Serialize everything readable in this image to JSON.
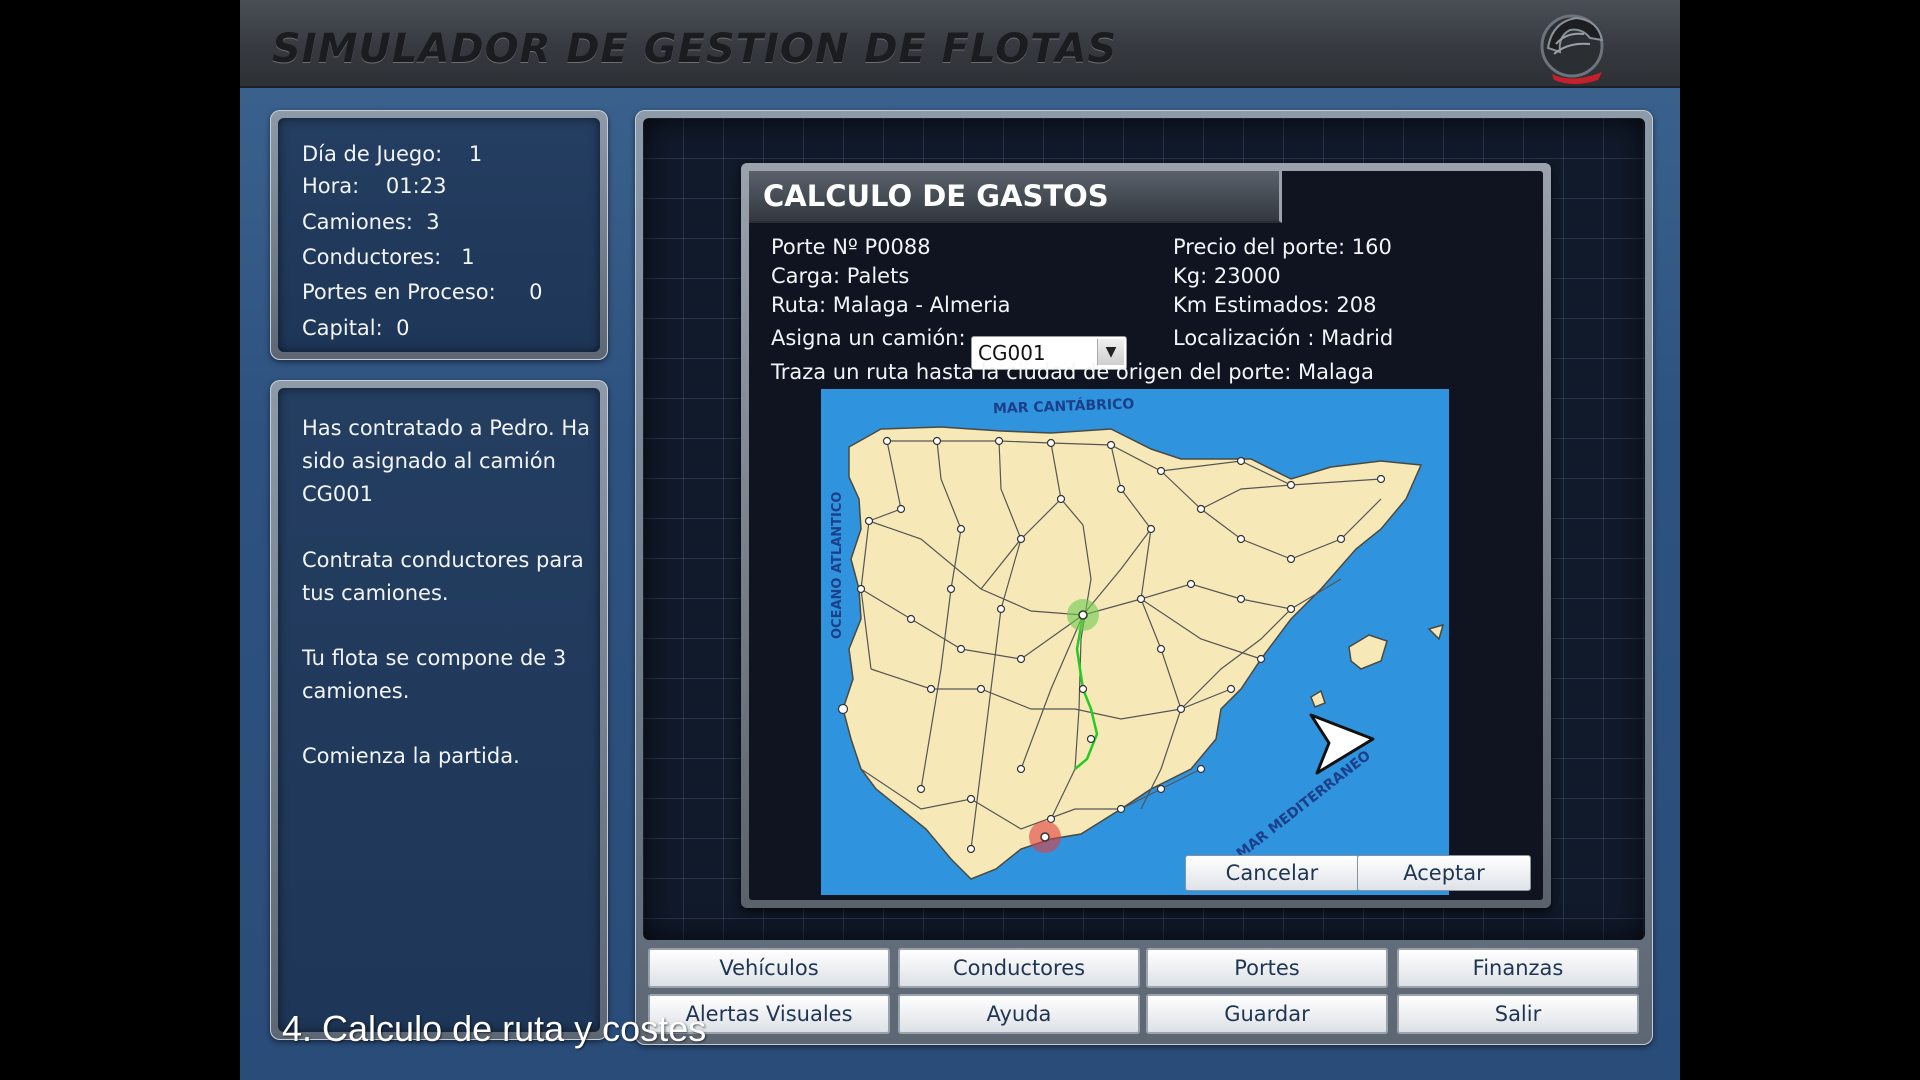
{
  "app": {
    "title": "SIMULADOR DE GESTION DE FLOTAS"
  },
  "stats": {
    "dia_label": "Día de Juego:",
    "dia_value": "1",
    "hora_label": "Hora:",
    "hora_value": "01:23",
    "camiones_label": "Camiones:",
    "camiones_value": "3",
    "conductores_label": "Conductores:",
    "conductores_value": "1",
    "portes_label": "Portes en Proceso:",
    "portes_value": "0",
    "capital_label": "Capital:",
    "capital_value": "0"
  },
  "messages": [
    "Has contratado a Pedro. Ha sido asignado al camión CG001",
    "Contrata conductores para tus camiones.",
    "Tu flota se compone de 3 camiones.",
    "Comienza la partida."
  ],
  "dialog": {
    "title": "CALCULO DE GASTOS",
    "porte": "Porte Nº P0088",
    "carga": "Carga: Palets",
    "ruta": "Ruta: Malaga - Almeria",
    "asigna_label": "Asigna un camión:",
    "truck_selected": "CG001",
    "precio": "Precio del porte: 160",
    "kg": "Kg: 23000",
    "km": "Km Estimados: 208",
    "localizacion": "Localización : Madrid",
    "instruction": "Traza un ruta hasta la ciudad de origen del porte: Malaga",
    "cancel_label": "Cancelar",
    "accept_label": "Aceptar"
  },
  "map": {
    "sea_north": "MAR CANTÁBRICO",
    "sea_west": "OCEANO ATLANTICO",
    "sea_east": "MAR MEDITERRANEO",
    "colors": {
      "sea": "#2f93de",
      "land": "#f7e8b8",
      "route": "#22cc22",
      "origin": "#e04040",
      "current": "#6ccb50"
    }
  },
  "nav": {
    "row1": [
      "Vehículos",
      "Conductores",
      "Portes",
      "Finanzas"
    ],
    "row2": [
      "Alertas Visuales",
      "Ayuda",
      "Guardar",
      "Salir"
    ]
  },
  "caption": "4. Calculo de ruta y costes"
}
